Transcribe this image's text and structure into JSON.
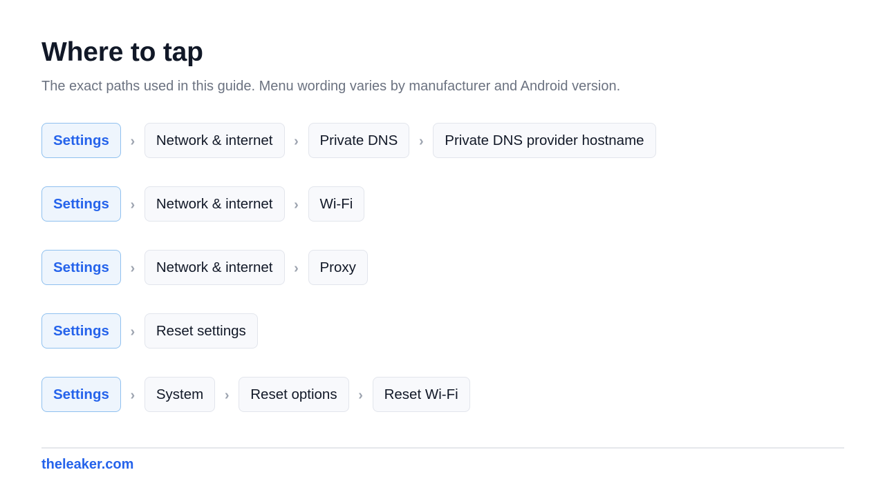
{
  "title": "Where to tap",
  "subtitle": "The exact paths used in this guide. Menu wording varies by manufacturer and Android version.",
  "separator": "›",
  "paths": [
    {
      "steps": [
        "Settings",
        "Network & internet",
        "Private DNS",
        "Private DNS provider hostname"
      ]
    },
    {
      "steps": [
        "Settings",
        "Network & internet",
        "Wi-Fi"
      ]
    },
    {
      "steps": [
        "Settings",
        "Network & internet",
        "Proxy"
      ]
    },
    {
      "steps": [
        "Settings",
        "Reset settings"
      ]
    },
    {
      "steps": [
        "Settings",
        "System",
        "Reset options",
        "Reset Wi-Fi"
      ]
    }
  ],
  "footer": {
    "link_text": "theleaker.com"
  },
  "colors": {
    "accent": "#2563eb",
    "root_bg": "#eef5fd",
    "root_border": "#8fc0ef",
    "crumb_bg": "#f8f9fc",
    "crumb_border": "#e2e5ec",
    "muted": "#6b7280"
  }
}
